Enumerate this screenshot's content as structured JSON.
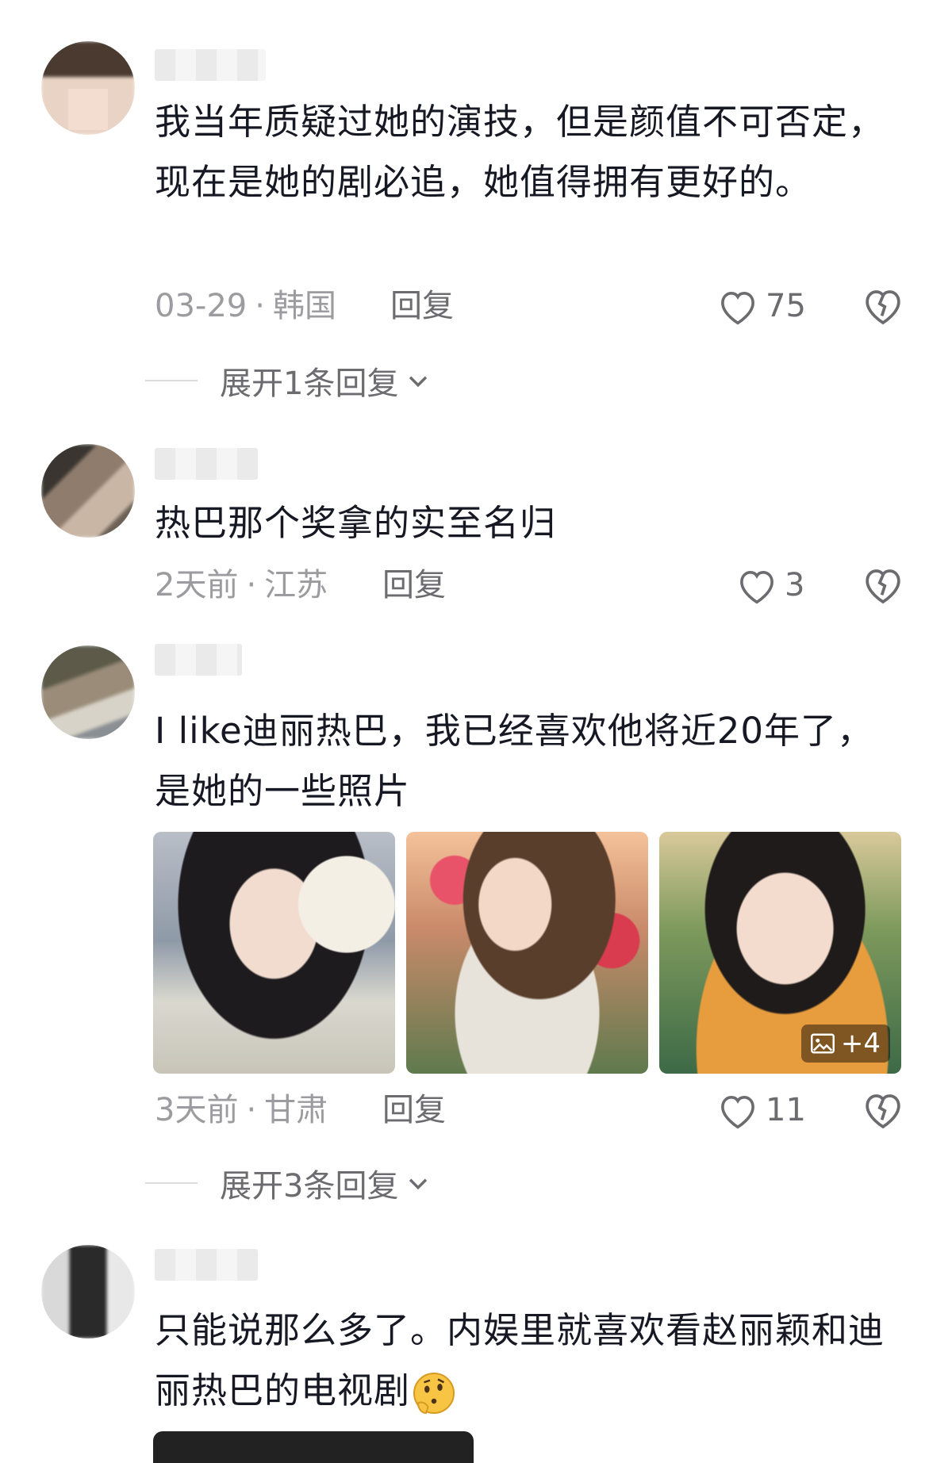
{
  "comments": [
    {
      "text": "我当年质疑过她的演技，但是颜值不可否定，现在是她的剧必追，她值得拥有更好的。",
      "date": "03-29",
      "location": "韩国",
      "reply_label": "回复",
      "likes": "75",
      "expand_label": "展开1条回复"
    },
    {
      "text": "热巴那个奖拿的实至名归",
      "date": "2天前",
      "location": "江苏",
      "reply_label": "回复",
      "likes": "3"
    },
    {
      "text": "I like迪丽热巴，我已经喜欢他将近20年了，是她的一些照片",
      "date": "3天前",
      "location": "甘肃",
      "reply_label": "回复",
      "likes": "11",
      "more_images": "+4",
      "expand_label": "展开3条回复"
    },
    {
      "text": "只能说那么多了。内娱里就喜欢看赵丽颖和迪丽热巴的电视剧"
    }
  ],
  "colors": {
    "text": "#161823",
    "meta": "#9b9ba0",
    "action": "#6b6b70"
  }
}
